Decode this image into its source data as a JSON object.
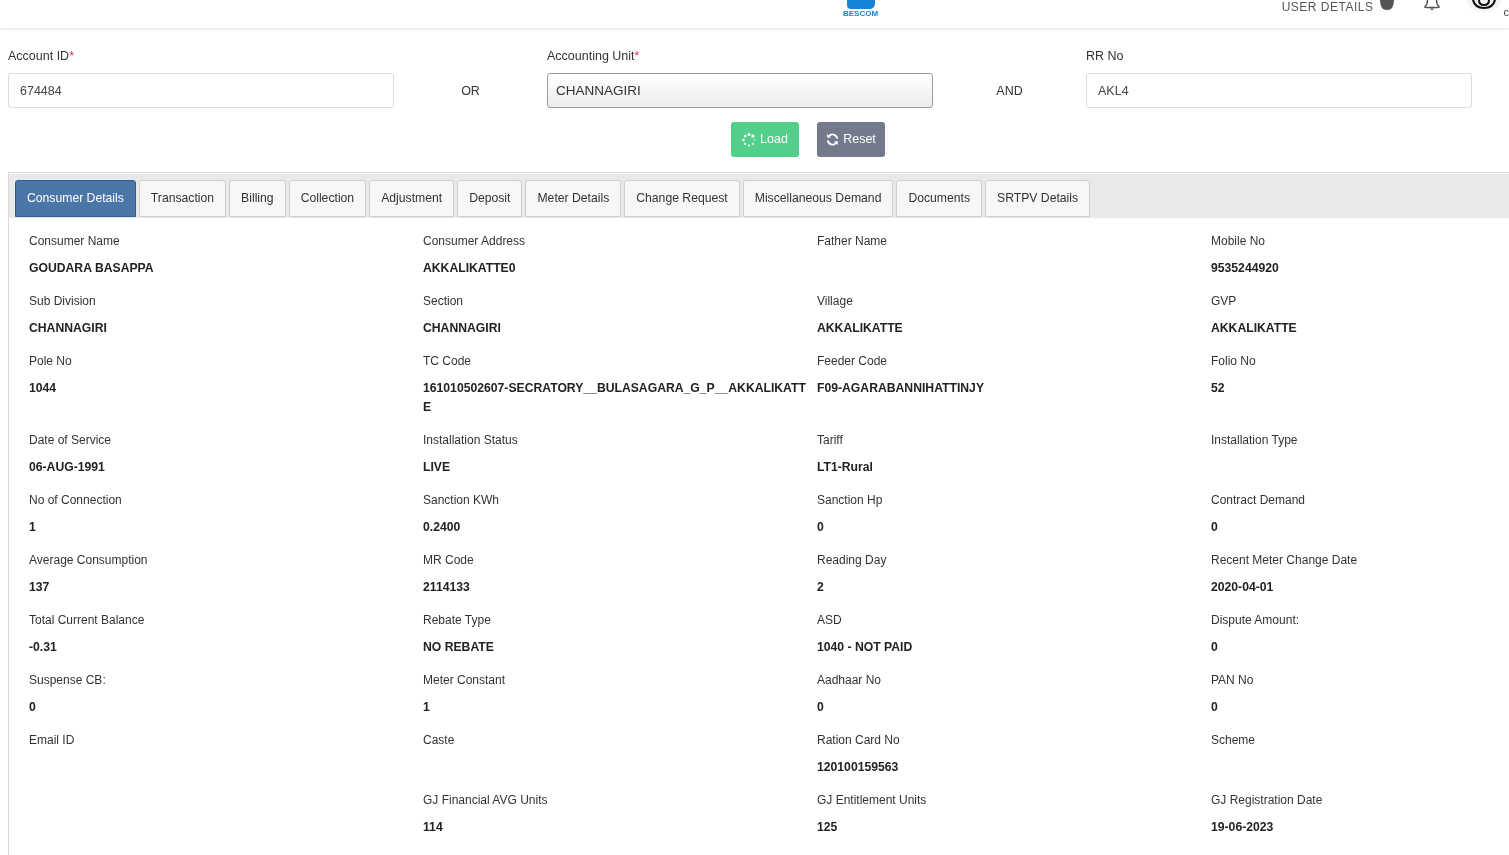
{
  "header": {
    "logo_text": "BESCOM",
    "user_menu": "USER DETAILS",
    "user_name": "c"
  },
  "search": {
    "fields": [
      {
        "kind": "text",
        "label": "Account ID",
        "required_mark": "*",
        "value": "674484"
      },
      {
        "kind": "combo",
        "label": "Accounting Unit",
        "required_mark": "*",
        "value": "CHANNAGIRI"
      },
      {
        "kind": "text",
        "label": "RR No",
        "value": "AKL4"
      }
    ],
    "connectors": [
      "OR",
      "AND"
    ],
    "buttons": [
      {
        "kind": "load",
        "label": "Load"
      },
      {
        "kind": "reset",
        "label": "Reset"
      }
    ]
  },
  "tabs": [
    {
      "label": "Consumer Details",
      "selected": true
    },
    {
      "label": "Transaction",
      "selected": false
    },
    {
      "label": "Billing",
      "selected": false
    },
    {
      "label": "Collection",
      "selected": false
    },
    {
      "label": "Adjustment",
      "selected": false
    },
    {
      "label": "Deposit",
      "selected": false
    },
    {
      "label": "Meter Details",
      "selected": false
    },
    {
      "label": "Change Request",
      "selected": false
    },
    {
      "label": "Miscellaneous Demand",
      "selected": false
    },
    {
      "label": "Documents",
      "selected": false
    },
    {
      "label": "SRTPV Details",
      "selected": false
    }
  ],
  "details": [
    {
      "kind": "field",
      "label": "Consumer Name",
      "value": "GOUDARA BASAPPA"
    },
    {
      "kind": "field",
      "label": "Consumer Address",
      "value": "AKKALIKATTE0"
    },
    {
      "kind": "field",
      "label": "Father Name"
    },
    {
      "kind": "field",
      "label": "Mobile No",
      "value": "9535244920"
    },
    {
      "kind": "field",
      "label": "Sub Division",
      "value": "CHANNAGIRI"
    },
    {
      "kind": "field",
      "label": "Section",
      "value": "CHANNAGIRI"
    },
    {
      "kind": "field",
      "label": "Village",
      "value": "AKKALIKATTE"
    },
    {
      "kind": "field",
      "label": "GVP",
      "value": "AKKALIKATTE"
    },
    {
      "kind": "field",
      "label": "Pole No",
      "value": "1044"
    },
    {
      "kind": "field",
      "label": "TC Code",
      "value": "161010502607-SECRATORY__BULASAGARA_G_P__AKKALIKATTE"
    },
    {
      "kind": "field",
      "label": "Feeder Code",
      "value": "F09-AGARABANNIHATTINJY"
    },
    {
      "kind": "field",
      "label": "Folio No",
      "value": "52"
    },
    {
      "kind": "field",
      "label": "Date of Service",
      "value": "06-AUG-1991"
    },
    {
      "kind": "field",
      "label": "Installation Status",
      "value": "LIVE"
    },
    {
      "kind": "field",
      "label": "Tariff",
      "value": "LT1-Rural"
    },
    {
      "kind": "field",
      "label": "Installation Type"
    },
    {
      "kind": "field",
      "label": "No of Connection",
      "value": "1"
    },
    {
      "kind": "field",
      "label": "Sanction KWh",
      "value": "0.2400"
    },
    {
      "kind": "field",
      "label": "Sanction Hp",
      "value": "0"
    },
    {
      "kind": "field",
      "label": "Contract Demand",
      "value": "0"
    },
    {
      "kind": "field",
      "label": "Average Consumption",
      "value": "137"
    },
    {
      "kind": "field",
      "label": "MR Code",
      "value": "2114133"
    },
    {
      "kind": "field",
      "label": "Reading Day",
      "value": "2"
    },
    {
      "kind": "field",
      "label": "Recent Meter Change Date",
      "value": "2020-04-01"
    },
    {
      "kind": "field",
      "label": "Total Current Balance",
      "value": "-0.31"
    },
    {
      "kind": "field",
      "label": "Rebate Type",
      "value": "NO REBATE"
    },
    {
      "kind": "field",
      "label": "ASD",
      "value": "1040 - NOT PAID"
    },
    {
      "kind": "field",
      "label": "Dispute Amount:",
      "value": "0"
    },
    {
      "kind": "field",
      "label": "Suspense CB:",
      "value": "0"
    },
    {
      "kind": "field",
      "label": "Meter Constant",
      "value": "1"
    },
    {
      "kind": "field",
      "label": "Aadhaar No",
      "value": "0"
    },
    {
      "kind": "field",
      "label": "PAN No",
      "value": "0"
    },
    {
      "kind": "field",
      "label": "Email ID"
    },
    {
      "kind": "field",
      "label": "Caste"
    },
    {
      "kind": "field",
      "label": "Ration Card No",
      "value": "120100159563"
    },
    {
      "kind": "field",
      "label": "Scheme"
    },
    {
      "kind": "empty"
    },
    {
      "kind": "field",
      "label": "GJ Financial AVG Units",
      "value": "114"
    },
    {
      "kind": "field",
      "label": "GJ Entitlement Units",
      "value": "125"
    },
    {
      "kind": "field",
      "label": "GJ Registration Date",
      "value": "19-06-2023"
    }
  ]
}
